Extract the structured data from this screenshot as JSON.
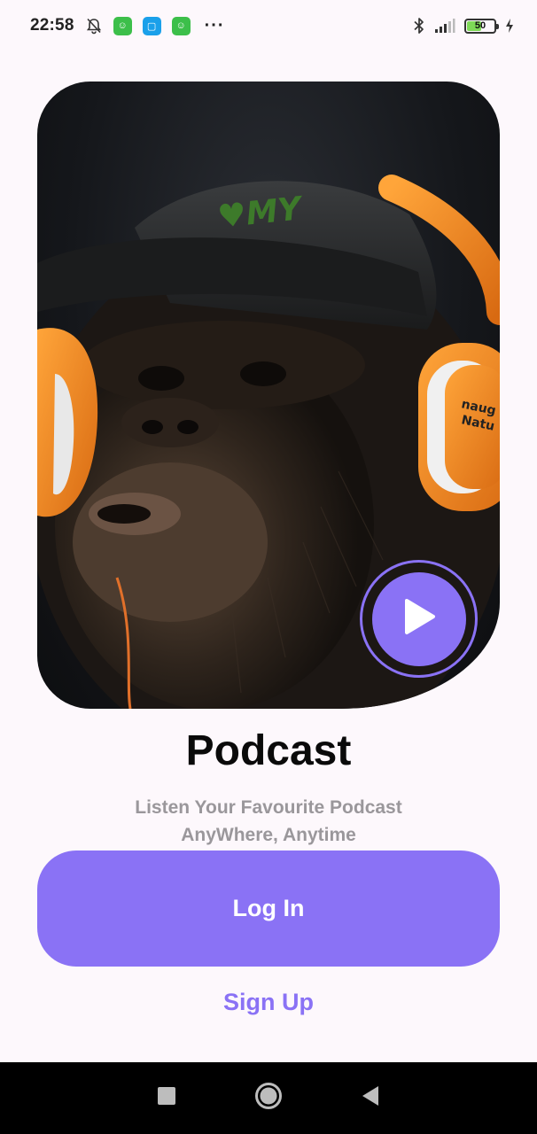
{
  "status_bar": {
    "time": "22:58",
    "dots": "···",
    "battery_level": "50",
    "icons": [
      "bell-off-icon",
      "app-icon-green",
      "app-icon-blue",
      "app-icon-green",
      "bluetooth-icon",
      "signal-icon",
      "battery-icon",
      "charging-icon"
    ]
  },
  "hero": {
    "image": "chimpanzee wearing cap and orange headphones",
    "accent_color": "#8a72f5"
  },
  "play_button": {
    "icon": "play-icon"
  },
  "title": "Podcast",
  "subtitle_line1": "Listen Your Favourite Podcast",
  "subtitle_line2": "AnyWhere, Anytime",
  "login_button": {
    "label": "Log In"
  },
  "signup_link": {
    "label": "Sign Up"
  },
  "nav_bar": {
    "buttons": [
      "recents-square-icon",
      "home-circle-icon",
      "back-triangle-icon"
    ]
  },
  "colors": {
    "background": "#fdf8fc",
    "primary": "#8a72f5",
    "subtitle": "#9a979b",
    "title": "#0a0a0a"
  }
}
